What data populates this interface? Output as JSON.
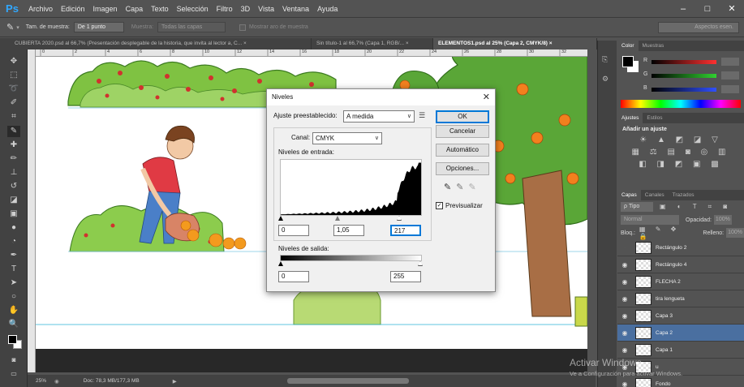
{
  "app": {
    "logo": "Ps"
  },
  "menu": [
    "Archivo",
    "Edición",
    "Imagen",
    "Capa",
    "Texto",
    "Selección",
    "Filtro",
    "3D",
    "Vista",
    "Ventana",
    "Ayuda"
  ],
  "window_controls": [
    "–",
    "□",
    "✕"
  ],
  "options": {
    "sample_size_label": "Tam. de muestra:",
    "sample_size_value": "De 1 punto",
    "sample_label": "Muestra:",
    "sample_value": "Todas las capas",
    "show_ring_label": "Mostrar aro de muestra",
    "workspace": "Aspectos esen."
  },
  "tabs": [
    "CUBIERTA 2020.psd al 66,7% (Presentación desplegable de la historia, que invita al lector a, C... ×",
    "Sin título-1 al 66,7% (Capa 1, RGB/... ×",
    "ELEMENTOS1.psd al 25% (Capa 2, CMYK/8) ×"
  ],
  "ruler_ticks": [
    "0",
    "2",
    "4",
    "6",
    "8",
    "10",
    "12",
    "14",
    "16",
    "18",
    "20",
    "22",
    "24",
    "26",
    "28",
    "30",
    "32"
  ],
  "status": {
    "zoom": "25%",
    "doc": "Doc: 78,3 MB/177,3 MB"
  },
  "watermark": {
    "line1": "Activar Windows",
    "line2": "Ve a Configuración para activar Windows."
  },
  "dialog": {
    "title": "Niveles",
    "preset_label": "Ajuste preestablecido:",
    "preset_value": "A medida",
    "channel_label": "Canal:",
    "channel_value": "CMYK",
    "input_label": "Niveles de entrada:",
    "input_black": "0",
    "input_gamma": "1,05",
    "input_white": "217",
    "output_label": "Niveles de salida:",
    "output_black": "0",
    "output_white": "255",
    "ok": "OK",
    "cancel": "Cancelar",
    "auto": "Automático",
    "options": "Opciones...",
    "preview": "Previsualizar"
  },
  "panels": {
    "color_tabs": [
      "Color",
      "Muestras"
    ],
    "sliders": [
      {
        "label": "R",
        "color": "#ff3030"
      },
      {
        "label": "G",
        "color": "#30d030"
      },
      {
        "label": "B",
        "color": "#3050ff"
      }
    ],
    "adjust_tabs": [
      "Ajustes",
      "Estilos"
    ],
    "adjust_title": "Añadir un ajuste",
    "layers_tabs": [
      "Capas",
      "Canales",
      "Trazados"
    ],
    "kind_label": "Tipo",
    "blend_mode": "Normal",
    "opacity_label": "Opacidad:",
    "opacity_value": "100%",
    "lock_label": "Bloq.:",
    "fill_label": "Relleno:",
    "fill_value": "100%",
    "layers": [
      {
        "name": "Rectángulo 2",
        "visible": false
      },
      {
        "name": "Rectángulo 4",
        "visible": true
      },
      {
        "name": "FLECHA 2",
        "visible": true
      },
      {
        "name": "tira lengueta",
        "visible": true
      },
      {
        "name": "Capa 3",
        "visible": true
      },
      {
        "name": "Capa 2",
        "visible": true,
        "selected": true
      },
      {
        "name": "Capa 1",
        "visible": true
      },
      {
        "name": "u",
        "visible": true
      },
      {
        "name": "Fondo",
        "visible": true
      }
    ]
  },
  "colors": {
    "accent": "#31a8ff",
    "selected_layer": "#4a6fa0"
  }
}
